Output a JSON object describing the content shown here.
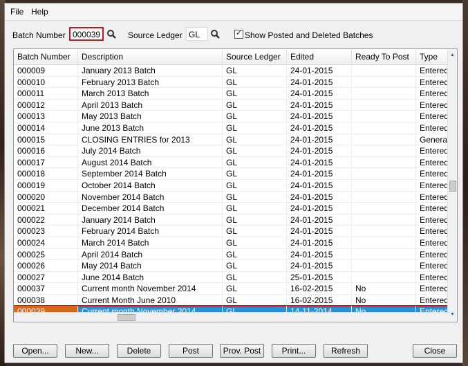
{
  "menu": {
    "file": "File",
    "help": "Help"
  },
  "filters": {
    "batch_number_label": "Batch Number",
    "batch_number_value": "000039",
    "source_ledger_label": "Source Ledger",
    "source_ledger_value": "GL",
    "show_posted_label": "Show Posted and Deleted Batches",
    "show_posted_checked": true
  },
  "grid": {
    "columns": [
      "Batch Number",
      "Description",
      "Source Ledger",
      "Edited",
      "Ready To Post",
      "Type"
    ],
    "rows": [
      [
        "000009",
        "January 2013 Batch",
        "GL",
        "24-01-2015",
        "",
        "Entered"
      ],
      [
        "000010",
        "February 2013 Batch",
        "GL",
        "24-01-2015",
        "",
        "Entered"
      ],
      [
        "000011",
        "March 2013 Batch",
        "GL",
        "24-01-2015",
        "",
        "Entered"
      ],
      [
        "000012",
        "April 2013 Batch",
        "GL",
        "24-01-2015",
        "",
        "Entered"
      ],
      [
        "000013",
        "May 2013 Batch",
        "GL",
        "24-01-2015",
        "",
        "Entered"
      ],
      [
        "000014",
        "June 2013 Batch",
        "GL",
        "24-01-2015",
        "",
        "Entered"
      ],
      [
        "000015",
        "CLOSING ENTRIES for 2013",
        "GL",
        "24-01-2015",
        "",
        "Generate"
      ],
      [
        "000016",
        "July 2014 Batch",
        "GL",
        "24-01-2015",
        "",
        "Entered"
      ],
      [
        "000017",
        "August 2014 Batch",
        "GL",
        "24-01-2015",
        "",
        "Entered"
      ],
      [
        "000018",
        "September 2014 Batch",
        "GL",
        "24-01-2015",
        "",
        "Entered"
      ],
      [
        "000019",
        "October 2014 Batch",
        "GL",
        "24-01-2015",
        "",
        "Entered"
      ],
      [
        "000020",
        "November 2014 Batch",
        "GL",
        "24-01-2015",
        "",
        "Entered"
      ],
      [
        "000021",
        "December 2014 Batch",
        "GL",
        "24-01-2015",
        "",
        "Entered"
      ],
      [
        "000022",
        "January 2014 Batch",
        "GL",
        "24-01-2015",
        "",
        "Entered"
      ],
      [
        "000023",
        "February 2014 Batch",
        "GL",
        "24-01-2015",
        "",
        "Entered"
      ],
      [
        "000024",
        "March 2014 Batch",
        "GL",
        "24-01-2015",
        "",
        "Entered"
      ],
      [
        "000025",
        "April 2014 Batch",
        "GL",
        "24-01-2015",
        "",
        "Entered"
      ],
      [
        "000026",
        "May 2014 Batch",
        "GL",
        "24-01-2015",
        "",
        "Entered"
      ],
      [
        "000027",
        "June 2014 Batch",
        "GL",
        "25-01-2015",
        "",
        "Entered"
      ],
      [
        "000037",
        "Current month November 2014",
        "GL",
        "16-02-2015",
        "No",
        "Entered"
      ],
      [
        "000038",
        "Current Month June 2010",
        "GL",
        "16-02-2015",
        "No",
        "Entered"
      ],
      [
        "000039",
        "Current month November 2014",
        "GL",
        "14-11-2014",
        "No",
        "Entered"
      ]
    ],
    "selected_row": 21
  },
  "buttons": {
    "open": "Open...",
    "new": "New...",
    "delete": "Delete",
    "post": "Post",
    "prov_post": "Prov. Post",
    "print": "Print...",
    "refresh": "Refresh",
    "close": "Close"
  },
  "colors": {
    "selection": "#2a8fd8",
    "highlight_border": "#c0181e",
    "selected_key_cell": "#d9661c"
  }
}
